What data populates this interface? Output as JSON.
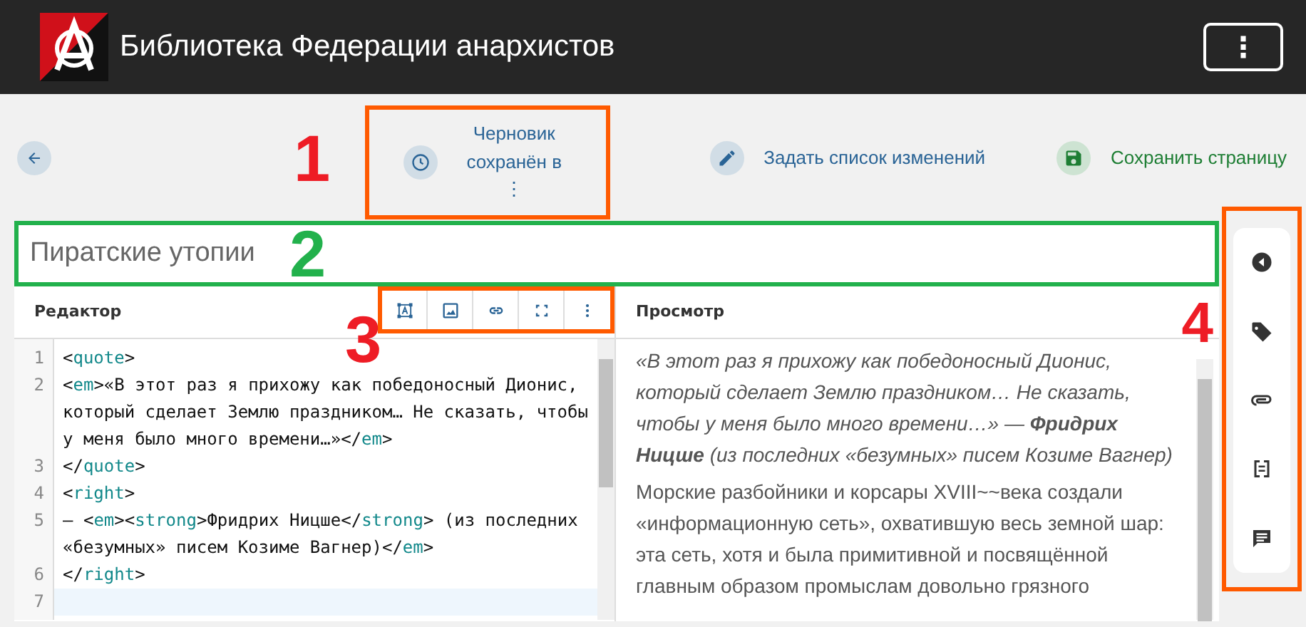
{
  "app": {
    "title": "Библиотека Федерации анархистов",
    "menu_button": "⋮"
  },
  "toolbar": {
    "actions": [
      {
        "kind": "draft",
        "label": "Черновик сохранён в",
        "more": "⋮",
        "annotation": {
          "label": "1",
          "color": "#ee1c25"
        }
      },
      {
        "kind": "changes",
        "label": "Задать список изменений"
      },
      {
        "kind": "save",
        "label": "Сохранить страницу"
      }
    ]
  },
  "title_field": {
    "value": "Пиратские утопии",
    "annotation": {
      "label": "2",
      "color": "#22b14c"
    }
  },
  "editor": {
    "heading": "Редактор",
    "tools_annotation": {
      "label": "3",
      "color": "#ee1c25"
    },
    "lines": [
      {
        "number": "1",
        "text": "<quote>",
        "current": false
      },
      {
        "number": "2",
        "text": "<em>«В этот раз я прихожу как победоносный Дионис, который сделает Землю праздником… Не сказать, чтобы у меня было много времени…»</em>",
        "current": false
      },
      {
        "number": "3",
        "text": "</quote>",
        "current": false
      },
      {
        "number": "4",
        "text": "<right>",
        "current": false
      },
      {
        "number": "5",
        "text": "– <em><strong>Фридрих Ницше</strong> (из последних «безумных» писем Козиме Вагнер)</em>",
        "current": false
      },
      {
        "number": "6",
        "text": "</right>",
        "current": false
      },
      {
        "number": "7",
        "current": true
      }
    ]
  },
  "preview": {
    "heading": "Просмотр",
    "annotation": {
      "label": "4",
      "color": "#ee1c25"
    },
    "paragraphs": [
      {
        "kind": "quote",
        "text": "«В этот раз я прихожу как победоносный Дионис, который сделает Землю праздником… Не сказать, чтобы у меня было много времени…» — **Фридрих Ницше** (из последних «безумных» писем Козиме Вагнер)"
      },
      {
        "kind": "body",
        "text": "Морские разбойники и корсары XVIII~~века создали «информационную сеть», охватившую весь земной шар: эта сеть, хотя и была примитивной и посвящённой главным образом промыслам довольно грязного"
      }
    ]
  }
}
